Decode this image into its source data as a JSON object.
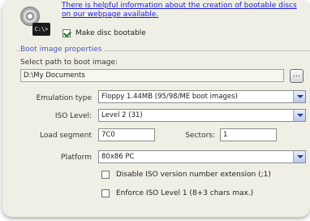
{
  "info": {
    "help_link": "There is helpful information about the creation of bootable discs on our webpage available.",
    "disc_badge": "C:\\>",
    "make_bootable_label": "Make disc bootable",
    "make_bootable_checked": true
  },
  "boot_image": {
    "group_title": "Boot image properties",
    "path_label": "Select path to boot image:",
    "path_value": "D:\\My Documents",
    "browse_label": "...",
    "emulation_label": "Emulation type",
    "emulation_value": "Floppy 1.44MB (95/98/ME boot images)",
    "iso_level_label": "ISO Level:",
    "iso_level_value": "Level 2 (31)",
    "load_segment_label": "Load segment",
    "load_segment_value": "7C0",
    "sectors_label": "Sectors:",
    "sectors_value": "1",
    "platform_label": "Platform",
    "platform_value": "80x86 PC",
    "disable_iso_label": "Disable ISO version number extension (;1)",
    "disable_iso_checked": false,
    "enforce_iso_label": "Enforce ISO Level 1 (8+3 chars max.)",
    "enforce_iso_checked": false
  },
  "colors": {
    "panel_bg": "#f0efe6",
    "link": "#1a1ae0",
    "group_title": "#4a56b8",
    "check_mark": "#1a7a1a"
  }
}
